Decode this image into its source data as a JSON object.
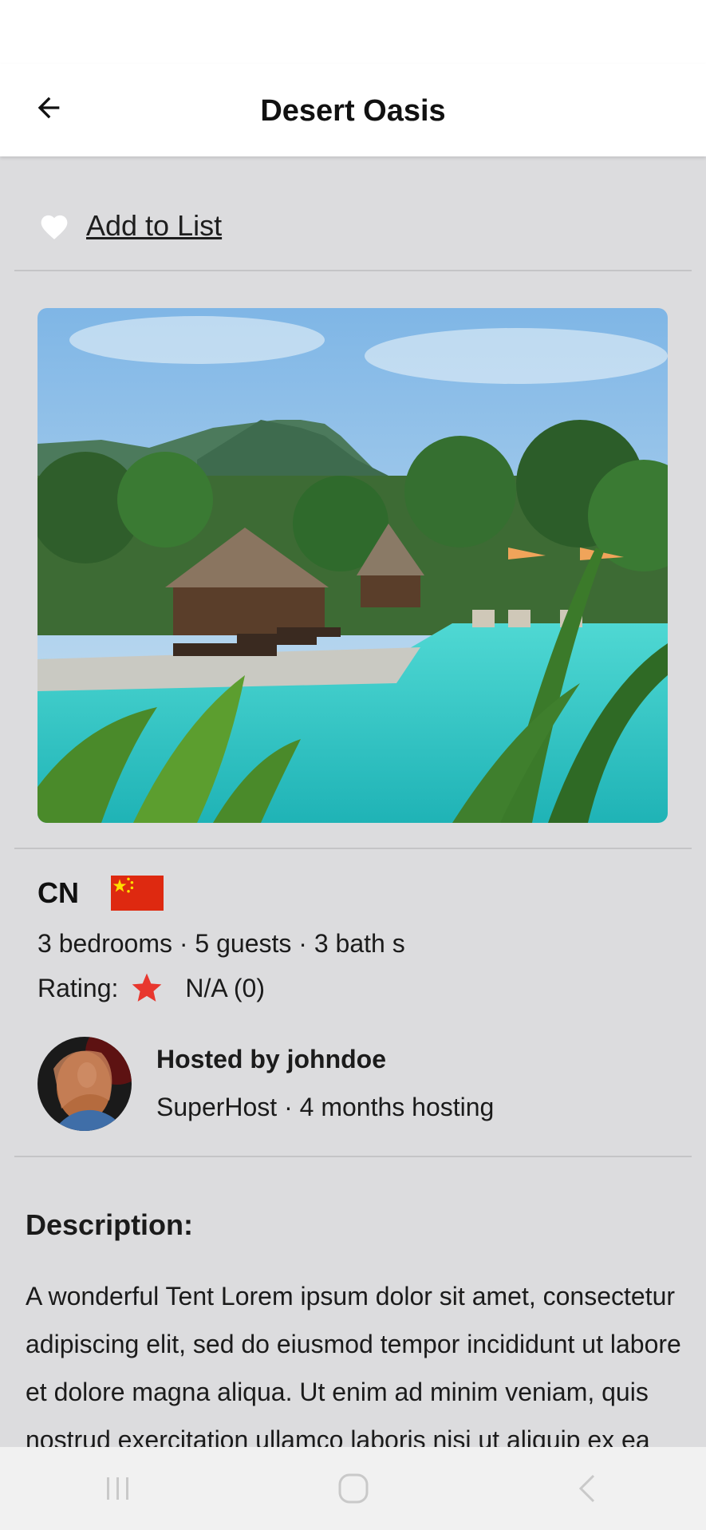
{
  "app_bar": {
    "title": "Desert Oasis",
    "back_icon": "arrow-left-icon"
  },
  "favorite": {
    "label": "Add to List",
    "icon": "heart-icon",
    "icon_color": "#ffffff"
  },
  "photo": {
    "alt": "resort pool with palm trees and mountains"
  },
  "country": {
    "code": "CN",
    "flag_icon": "china-flag-icon"
  },
  "details": "3 bedrooms · 5 guests · 3 bath s",
  "rating": {
    "label": "Rating:",
    "icon": "star-icon",
    "icon_color": "#e8372e",
    "value": "N/A (0)"
  },
  "host": {
    "name": "Hosted by johndoe",
    "meta": "SuperHost · 4 months hosting"
  },
  "description": {
    "title": "Description:",
    "text": "A wonderful Tent Lorem ipsum dolor sit amet, consectetur adipiscing elit, sed do eiusmod tempor incididunt ut labore et dolore magna aliqua. Ut enim ad minim veniam, quis nostrud exercitation ullamco laboris nisi ut aliquip ex ea commodo consequat."
  },
  "nav": {
    "recents_icon": "recents-icon",
    "home_icon": "home-icon",
    "back_icon": "nav-back-icon"
  },
  "colors": {
    "background": "#dcdcde",
    "app_bar": "#ffffff",
    "nav_bar": "#f1f1f1"
  }
}
